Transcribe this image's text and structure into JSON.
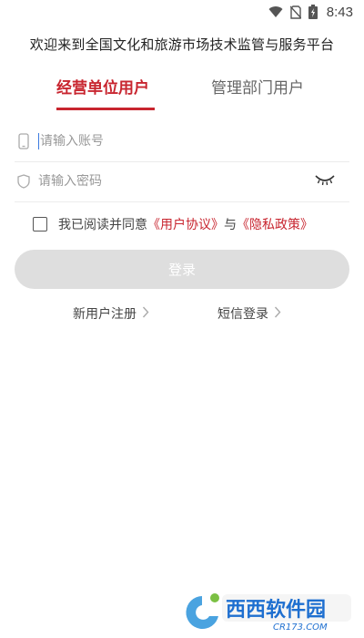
{
  "status_bar": {
    "time": "8:43",
    "icons": [
      "wifi-icon",
      "no-sim-icon",
      "battery-charging-icon"
    ]
  },
  "page": {
    "title": "欢迎来到全国文化和旅游市场技术监管与服务平台"
  },
  "tabs": [
    {
      "label": "经营单位用户",
      "active": true
    },
    {
      "label": "管理部门用户",
      "active": false
    }
  ],
  "form": {
    "account_placeholder": "请输入账号",
    "account_value": "",
    "password_placeholder": "请输入密码",
    "password_value": "",
    "password_toggle_icon": "eye-closed-icon"
  },
  "agreement": {
    "checked": false,
    "prefix": "我已阅读并同意",
    "user_agreement": "《用户协议》",
    "connector": "与",
    "privacy_policy": "《隐私政策》"
  },
  "login_button": {
    "label": "登录"
  },
  "links": {
    "register": "新用户注册",
    "sms_login": "短信登录"
  },
  "watermark": {
    "text_cn": "西西软件园",
    "text_en": "CR173.COM"
  },
  "colors": {
    "accent": "#c8252f",
    "disabled_button": "#dedede",
    "divider": "#ececec"
  }
}
